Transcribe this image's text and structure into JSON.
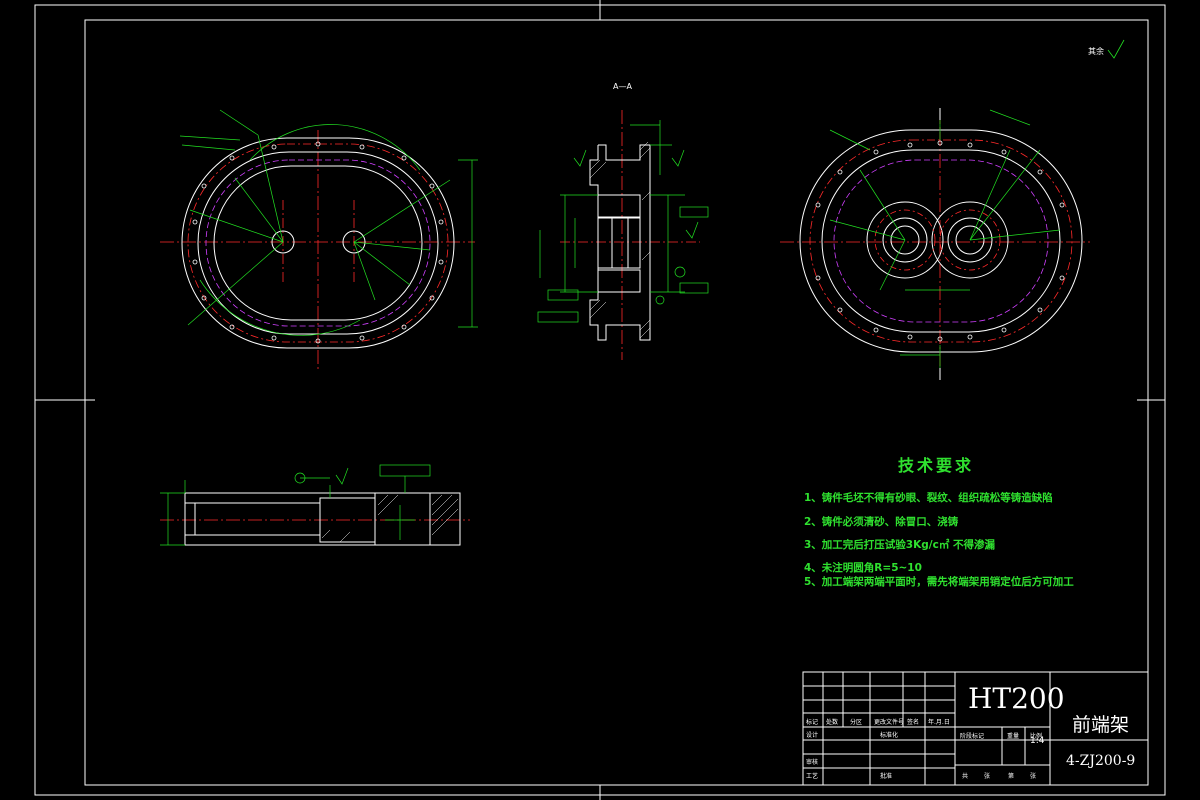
{
  "drawing": {
    "section_label": "A—A",
    "roughness_note": "其余"
  },
  "technical_requirements": {
    "title": "技术要求",
    "items": [
      "1、铸件毛坯不得有砂眼、裂纹、组织疏松等铸造缺陷",
      "2、铸件必须清砂、除冒口、浇铸",
      "3、加工完后打压试验3Kg/c㎡ 不得渗漏",
      "4、未注明圆角R=5~10",
      "5、加工端架两端平面时，需先将端架用销定位后方可加工"
    ]
  },
  "title_block": {
    "material": "HT200",
    "part_name": "前端架",
    "drawing_number": "4-ZJ200-9",
    "scale_value": "1:4",
    "header_cells": [
      "标记",
      "处数",
      "分区",
      "更改文件号",
      "签名",
      "年.月.日"
    ],
    "left_rows": [
      "设计",
      "审核",
      "工艺"
    ],
    "std_cell": "标准化",
    "approve_cell": "批准",
    "stage_labels": [
      "阶段标记",
      "重量",
      "比例"
    ],
    "sheet_labels": [
      "共",
      "张",
      "第",
      "张"
    ]
  },
  "colors": {
    "background": "#000000",
    "outline": "#ffffff",
    "centerline": "#ff2a2a",
    "dimension": "#22e022",
    "hidden": "#d040ff",
    "note_text": "#2fe02f"
  }
}
